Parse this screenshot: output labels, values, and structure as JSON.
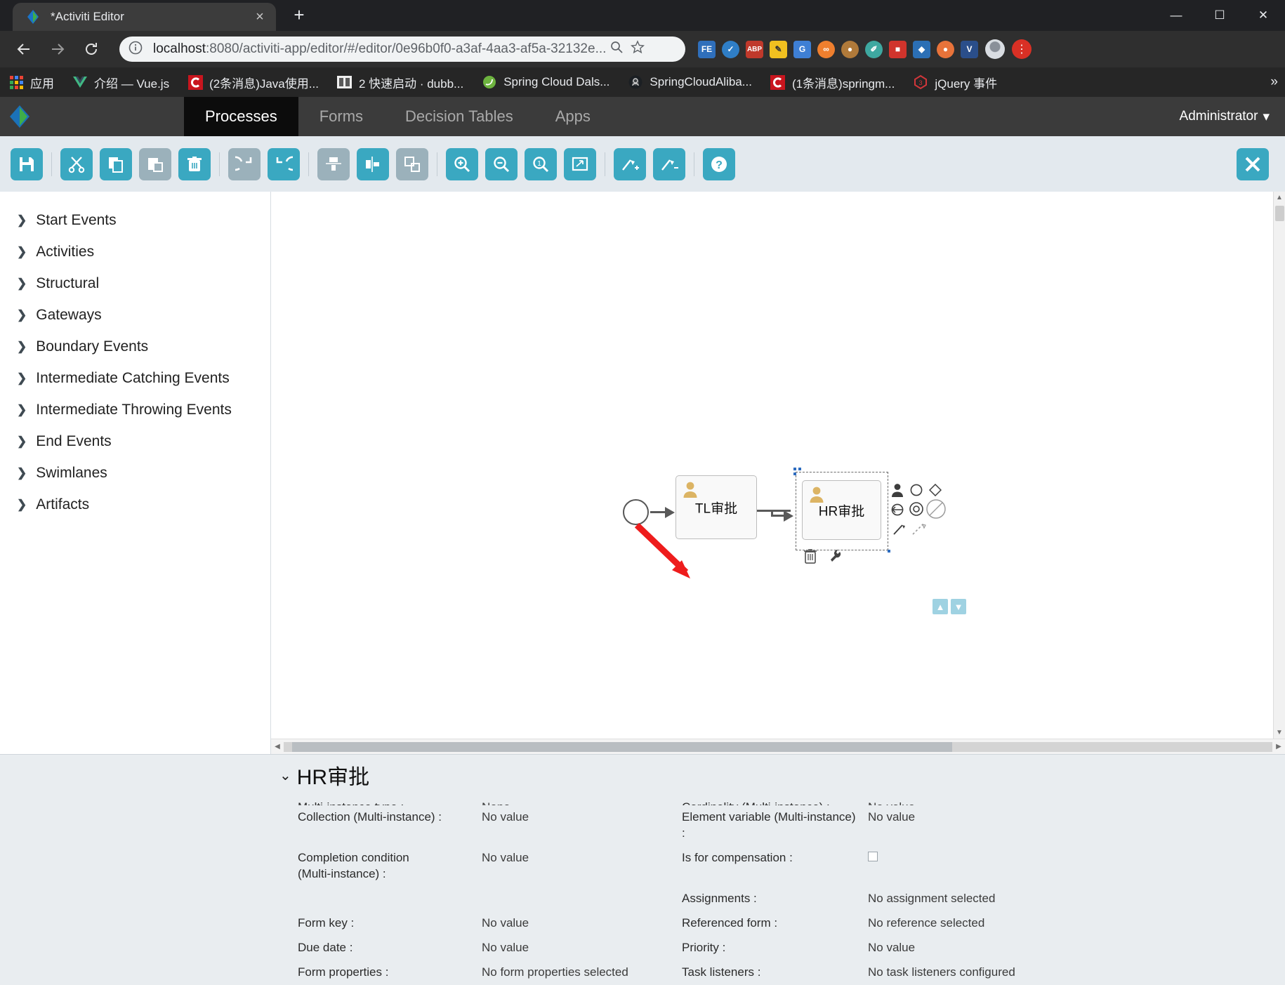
{
  "browser": {
    "tab": {
      "title": "*Activiti Editor",
      "favicon": "activiti-diamond-icon",
      "close_icon": "close-icon"
    },
    "new_tab_icon": "plus-icon",
    "window_controls": {
      "minimize": "minimize-icon",
      "maximize": "maximize-icon",
      "close": "close-icon"
    },
    "nav": {
      "back_icon": "arrow-left-icon",
      "forward_icon": "arrow-right-icon",
      "reload_icon": "reload-icon"
    },
    "omnibox": {
      "info_icon": "info-circle-icon",
      "url_host": "localhost",
      "url_rest": ":8080/activiti-app/editor/#/editor/0e96b0f0-a3af-4aa3-af5a-32132e...",
      "zoom_icon": "magnifier-icon",
      "bookmark_icon": "star-icon"
    },
    "extensions": [
      {
        "name": "fe-extension-icon",
        "label": "FE",
        "color": "#2f6fbb"
      },
      {
        "name": "check-extension-icon",
        "label": "✔",
        "color": "#2f7ec6"
      },
      {
        "name": "abp-extension-icon",
        "label": "ABP",
        "color": "#c0392b"
      },
      {
        "name": "pencil-extension-icon",
        "label": "✎",
        "color": "#f0c020"
      },
      {
        "name": "translate-extension-icon",
        "label": "G",
        "color": "#3e7fd4"
      },
      {
        "name": "infinity-extension-icon",
        "label": "∞",
        "color": "#ef7f2e"
      },
      {
        "name": "monkey-extension-icon",
        "label": "●",
        "color": "#b07a3a"
      },
      {
        "name": "leaf-extension-icon",
        "label": "✐",
        "color": "#3ea8a0"
      },
      {
        "name": "red-extension-icon",
        "label": "■",
        "color": "#d0342c"
      },
      {
        "name": "blue-extension-icon",
        "label": "◆",
        "color": "#2b6fb5"
      },
      {
        "name": "orange-extension-icon",
        "label": "●",
        "color": "#e8733a"
      },
      {
        "name": "v-extension-icon",
        "label": "V",
        "color": "#2a4e8a"
      }
    ],
    "profile_icon": "user-avatar-icon",
    "menu_icon": "chrome-menu-icon",
    "bookmarks": [
      {
        "label": "应用",
        "icon": "apps-grid-icon"
      },
      {
        "label": "介绍 — Vue.js",
        "icon": "vue-icon"
      },
      {
        "label": "(2条消息)Java使用...",
        "icon": "csdn-icon"
      },
      {
        "label": "2 快速启动 · dubb...",
        "icon": "dubbo-icon"
      },
      {
        "label": "Spring Cloud Dals...",
        "icon": "spring-icon"
      },
      {
        "label": "SpringCloudAliba...",
        "icon": "github-icon"
      },
      {
        "label": "(1条消息)springm...",
        "icon": "csdn-icon"
      },
      {
        "label": "jQuery 事件",
        "icon": "runoob-icon"
      }
    ],
    "bookmarks_overflow": "»"
  },
  "app": {
    "logo": "activiti-logo-icon",
    "tabs": [
      {
        "label": "Processes",
        "active": true
      },
      {
        "label": "Forms",
        "active": false
      },
      {
        "label": "Decision Tables",
        "active": false
      },
      {
        "label": "Apps",
        "active": false
      }
    ],
    "user_menu": {
      "label": "Administrator",
      "caret": "▾"
    }
  },
  "toolbar": {
    "buttons": [
      {
        "name": "save-button",
        "icon": "save-icon",
        "enabled": true
      },
      {
        "name": "cut-button",
        "icon": "scissors-icon",
        "enabled": true
      },
      {
        "name": "copy-button",
        "icon": "copy-icon",
        "enabled": true
      },
      {
        "name": "paste-button",
        "icon": "paste-icon",
        "enabled": false
      },
      {
        "name": "delete-button",
        "icon": "trash-icon",
        "enabled": true
      },
      {
        "name": "redo-button",
        "icon": "redo-arrow-icon",
        "enabled": false
      },
      {
        "name": "undo-button",
        "icon": "undo-arrow-icon",
        "enabled": true
      },
      {
        "name": "align-vertical-button",
        "icon": "align-vertical-icon",
        "enabled": false
      },
      {
        "name": "align-horizontal-button",
        "icon": "align-horizontal-icon",
        "enabled": false
      },
      {
        "name": "same-size-button",
        "icon": "same-size-icon",
        "enabled": false
      },
      {
        "name": "zoom-in-button",
        "icon": "zoom-in-icon",
        "enabled": true
      },
      {
        "name": "zoom-out-button",
        "icon": "zoom-out-icon",
        "enabled": true
      },
      {
        "name": "zoom-actual-button",
        "icon": "zoom-actual-icon",
        "enabled": true
      },
      {
        "name": "zoom-fit-button",
        "icon": "zoom-fit-icon",
        "enabled": true
      },
      {
        "name": "add-bendpoint-button",
        "icon": "add-bendpoint-icon",
        "enabled": true
      },
      {
        "name": "remove-bendpoint-button",
        "icon": "remove-bendpoint-icon",
        "enabled": true
      },
      {
        "name": "help-button",
        "icon": "question-mark-icon",
        "enabled": true
      }
    ],
    "close_editor": {
      "name": "close-editor-button",
      "icon": "close-x-icon"
    }
  },
  "palette": {
    "items": [
      {
        "label": "Start Events"
      },
      {
        "label": "Activities"
      },
      {
        "label": "Structural"
      },
      {
        "label": "Gateways"
      },
      {
        "label": "Boundary Events"
      },
      {
        "label": "Intermediate Catching Events"
      },
      {
        "label": "Intermediate Throwing Events"
      },
      {
        "label": "End Events"
      },
      {
        "label": "Swimlanes"
      },
      {
        "label": "Artifacts"
      }
    ],
    "chevron": "❯"
  },
  "diagram": {
    "start_event": {
      "name": "start-event-shape"
    },
    "tasks": [
      {
        "label": "TL审批",
        "type": "user-task"
      },
      {
        "label": "HR审批",
        "type": "user-task",
        "selected": true
      }
    ],
    "selected_quick_menu": [
      "user-task-icon",
      "circle-icon",
      "gateway-icon",
      "task-left-icon",
      "target-icon",
      "end-event-icon",
      "sequence-flow-icon",
      "association-icon"
    ],
    "shape_tools": [
      {
        "icon": "trash-icon",
        "name": "delete-shape-button"
      },
      {
        "icon": "wrench-icon",
        "name": "morph-shape-button"
      }
    ],
    "updown": [
      {
        "icon": "chevron-up-icon",
        "name": "scroll-up-button"
      },
      {
        "icon": "chevron-down-icon",
        "name": "scroll-down-button"
      }
    ],
    "annotation": {
      "type": "red-arrow",
      "points_at": "Assignments"
    }
  },
  "properties": {
    "title": "HR审批",
    "collapse_chevron": "⌄",
    "rows": [
      {
        "label": "Multi-instance type :",
        "value": "None",
        "clipped": true,
        "label2": "Cardinality (Multi-instance) :",
        "value2": "No value"
      },
      {
        "label": "Collection (Multi-instance) :",
        "value": "No value",
        "label2": "Element variable (Multi-instance) :",
        "value2": "No value"
      },
      {
        "label": "Completion condition (Multi-instance) :",
        "value": "No value",
        "label2": "Is for compensation :",
        "value2": "",
        "value2_checkbox": true
      },
      {
        "label": "",
        "value": "",
        "label2": "Assignments :",
        "value2": "No assignment selected"
      },
      {
        "label": "Form key :",
        "value": "No value",
        "label2": "Referenced form :",
        "value2": "No reference selected"
      },
      {
        "label": "Due date :",
        "value": "No value",
        "label2": "Priority :",
        "value2": "No value"
      },
      {
        "label": "Form properties :",
        "value": "No form properties selected",
        "label2": "Task listeners :",
        "value2": "No task listeners configured"
      }
    ]
  },
  "colors": {
    "accent": "#3aa8c1",
    "accent_disabled": "#9bb1bb",
    "header_bg": "#3b3b3b",
    "tab_active_bg": "#0c0c0c",
    "toolbar_bg": "#e3e9ee",
    "props_bg": "#e9edf0",
    "annotation_red": "#ee1c1c"
  }
}
